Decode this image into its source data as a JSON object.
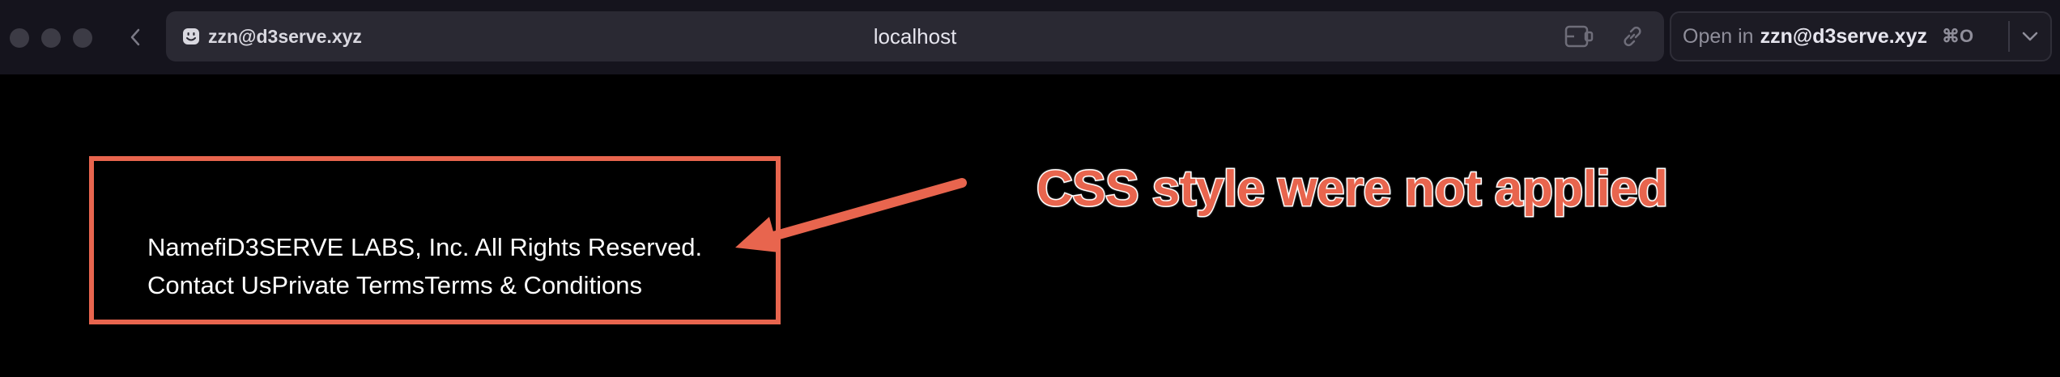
{
  "browser": {
    "profile_label": "zzn@d3serve.xyz",
    "url": "localhost",
    "open_in": {
      "prefix": "Open in",
      "target": "zzn@d3serve.xyz",
      "shortcut": "⌘O"
    },
    "icons": {
      "back": "chevron-left-icon",
      "profile": "smiley-icon",
      "sidebar": "sidebar-toggle-icon",
      "link": "link-icon",
      "dropdown": "chevron-down-icon"
    }
  },
  "page": {
    "copyright": "NamefiD3SERVE LABS, Inc. All Rights Reserved.",
    "links": [
      "Contact Us",
      "Private Terms",
      "Terms & Conditions"
    ]
  },
  "annotation": {
    "text": "CSS style were not applied",
    "color": "#e8654e"
  }
}
